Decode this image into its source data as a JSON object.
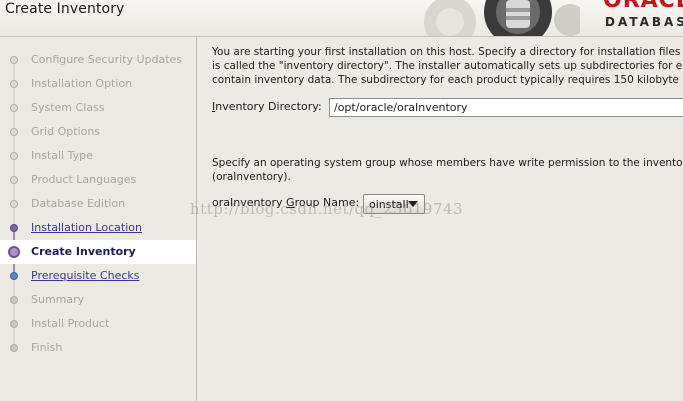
{
  "header": {
    "title": "Create Inventory",
    "brand_top": "ORACLE",
    "brand_bottom": "DATABASE"
  },
  "sidebar": {
    "steps": [
      {
        "label": "Configure Security Updates",
        "state": "done"
      },
      {
        "label": "Installation Option",
        "state": "done"
      },
      {
        "label": "System Class",
        "state": "done"
      },
      {
        "label": "Grid Options",
        "state": "done"
      },
      {
        "label": "Install Type",
        "state": "done"
      },
      {
        "label": "Product Languages",
        "state": "done"
      },
      {
        "label": "Database Edition",
        "state": "done"
      },
      {
        "label": "Installation Location",
        "state": "link"
      },
      {
        "label": "Create Inventory",
        "state": "current"
      },
      {
        "label": "Prerequisite Checks",
        "state": "link"
      },
      {
        "label": "Summary",
        "state": "pending"
      },
      {
        "label": "Install Product",
        "state": "pending"
      },
      {
        "label": "Finish",
        "state": "pending"
      }
    ]
  },
  "main": {
    "intro_line1": "You are starting your first installation on this host. Specify a directory for installation files",
    "intro_line2": "is called the \"inventory directory\". The installer automatically sets up subdirectories for e",
    "intro_line3": "contain inventory data. The subdirectory for each product typically requires 150 kilobyte",
    "inventory_dir_label_pre": "I",
    "inventory_dir_label_rest": "nventory Directory:",
    "inventory_dir_value": "/opt/oracle/oraInventory",
    "group_text_line1": "Specify an operating system group whose members have write permission to the invento",
    "group_text_line2": "(oraInventory).",
    "group_label_pre": "oraInventory ",
    "group_label_u": "G",
    "group_label_rest": "roup Name:",
    "group_value": "oinstall"
  },
  "watermark": "http://blog.csdn.net/qq_25619743"
}
